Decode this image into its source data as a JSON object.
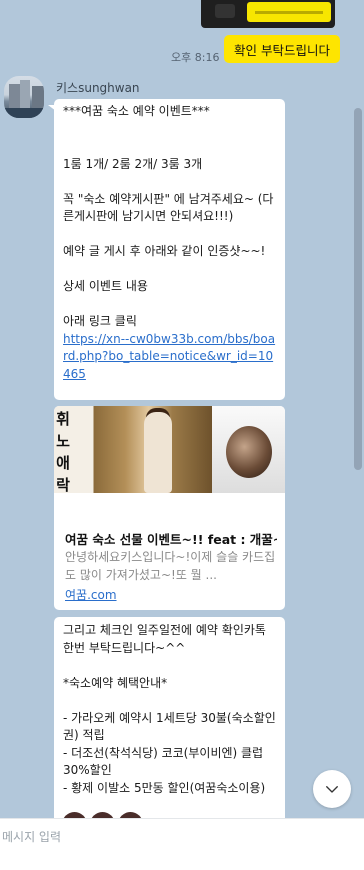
{
  "messages": {
    "my_time": "오후 8:16",
    "my_text": "확인 부탁드립니다",
    "sender_name": "키스sunghwan",
    "first_text": "***여꿈 숙소 예약 이벤트***\n\n\n1룸 1개/ 2룸 2개/ 3룸 3개\n\n꼭  \"숙소 예약게시판\" 에 남겨주세요~ (다른게시판에 남기시면 안되셔요!!!)\n\n예약 글 게시 후 아래와 같이 인증샷~~!\n\n상세 이벤트 내용\n\n아래 링크 클릭\n",
    "first_link": "https://xn--cw0bw33b.com/bbs/board.php?bo_table=notice&wr_id=10465",
    "card_title": "여꿈 숙소 선물 이벤트~!! feat : 개꿀~",
    "card_desc": "안녕하세요키스입니다~!이제 슬슬 카드집도 많이 가져가셨고~!또 뭘 ...",
    "card_domain": "여꿈.com",
    "card_image_text": [
      "휘",
      "노",
      "애",
      "락"
    ],
    "third_text": "그리고 체크인 일주일전에 예약 확인카톡 한번 부탁드립니다~^^\n\n*숙소예약 혜택안내*\n\n- 가라오케 예약시 1세트당 30불(숙소할인권) 적립\n- 더조선(착석식당) 코코(부이비엔) 클럽 30%할인\n- 황제 이발소  5만동 할인(여꿈숙소이용)"
  },
  "input": {
    "placeholder": "메시지 입력"
  },
  "icons": {
    "scroll_down": "chevron-down-icon"
  },
  "colors": {
    "background": "#b2c7da",
    "my_bubble": "#fee500",
    "link": "#2a6ecb"
  }
}
